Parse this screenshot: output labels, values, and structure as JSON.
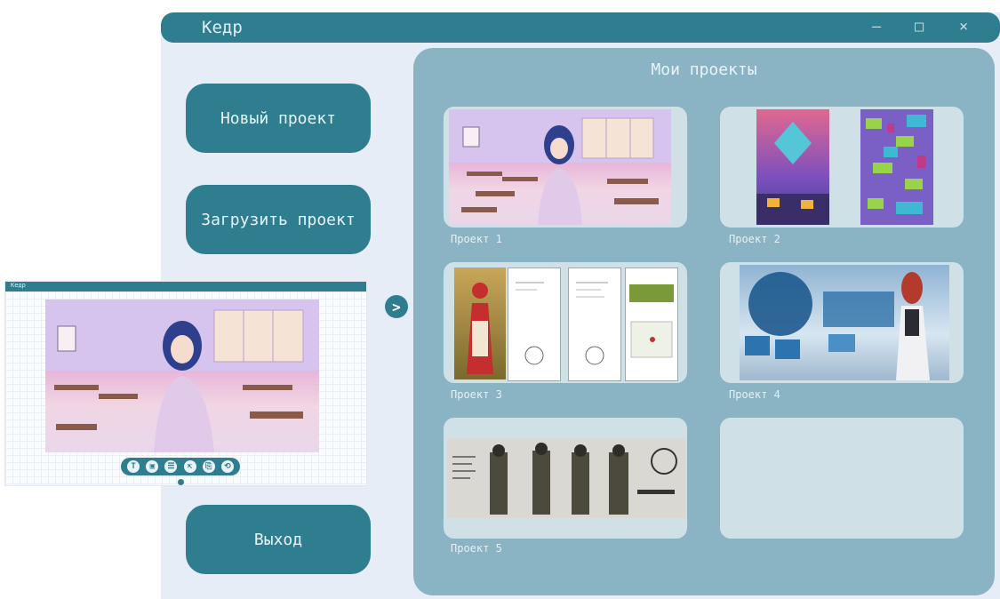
{
  "app": {
    "title": "Кедр"
  },
  "window_controls": {
    "minimize": "–",
    "maximize": "□",
    "close": "×"
  },
  "menu": {
    "new_project": "Новый проект",
    "load_project": "Загрузить проект",
    "exit": "Выход"
  },
  "projects": {
    "title": "Мои проекты",
    "items": [
      {
        "label": "Проект 1"
      },
      {
        "label": "Проект 2"
      },
      {
        "label": "Проект 3"
      },
      {
        "label": "Проект 4"
      },
      {
        "label": "Проект 5"
      }
    ]
  },
  "preview": {
    "title": "Кедр",
    "tools": [
      "T",
      "▣",
      "☰",
      "⇱",
      "⎘",
      "⟲"
    ]
  },
  "colors": {
    "accent": "#2f7e90",
    "panel": "#8ab3c3",
    "background": "#e6edf7"
  }
}
